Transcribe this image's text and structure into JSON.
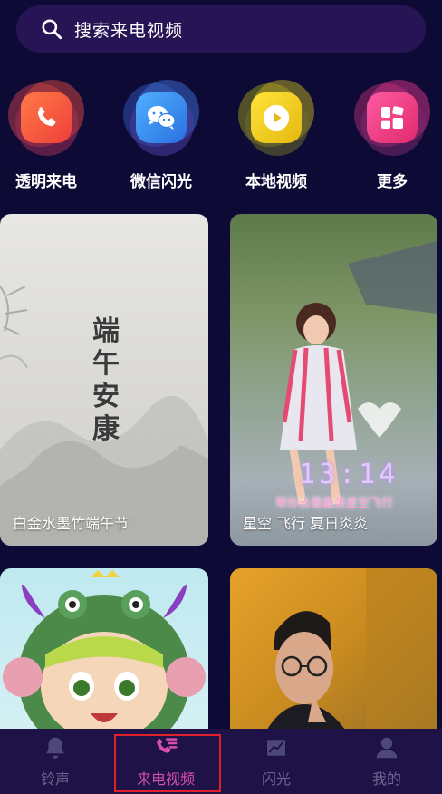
{
  "search": {
    "placeholder": "搜索来电视频"
  },
  "entries": [
    {
      "label": "透明来电",
      "icon": "phone-icon",
      "color": "#f2573d"
    },
    {
      "label": "微信闪光",
      "icon": "wechat-icon",
      "color": "#3a88e8"
    },
    {
      "label": "本地视频",
      "icon": "play-icon",
      "color": "#e0c21a"
    },
    {
      "label": "更多",
      "icon": "grid-icon",
      "color": "#e6327e"
    }
  ],
  "cards": [
    {
      "caption": "白金水墨竹端午节",
      "art_text": "端午安康"
    },
    {
      "caption": "星空 飞行 夏日炎炎",
      "clock": "13:14",
      "overlay": "带你去看最美星空飞行"
    },
    {
      "caption": ""
    },
    {
      "caption": ""
    }
  ],
  "tabs": [
    {
      "label": "铃声",
      "icon": "bell-icon",
      "active": false
    },
    {
      "label": "来电视频",
      "icon": "phone-list-icon",
      "active": true
    },
    {
      "label": "闪光",
      "icon": "chart-icon",
      "active": false
    },
    {
      "label": "我的",
      "icon": "user-icon",
      "active": false
    }
  ],
  "colors": {
    "background": "#0d0a35",
    "tab_active": "#d84fae",
    "tab_inactive": "#6d6690"
  }
}
